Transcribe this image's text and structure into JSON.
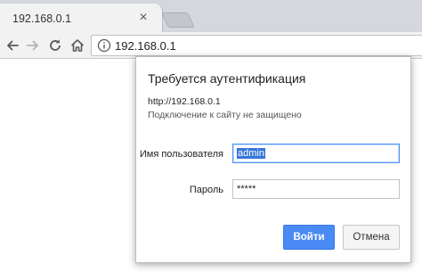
{
  "tab": {
    "title": "192.168.0.1",
    "close_glyph": "×"
  },
  "toolbar": {
    "back_icon": "back-arrow-icon",
    "forward_icon": "forward-arrow-icon",
    "reload_icon": "reload-icon",
    "home_icon": "home-icon",
    "url": "192.168.0.1"
  },
  "dialog": {
    "title": "Требуется аутентификация",
    "url": "http://192.168.0.1",
    "warning": "Подключение к сайту не защищено",
    "username_label": "Имя пользователя",
    "username_value": "admin",
    "password_label": "Пароль",
    "password_value": "*****",
    "login_button": "Войти",
    "cancel_button": "Отмена"
  },
  "colors": {
    "tabstrip": "#d4d7dc",
    "toolbar": "#f2f2f2",
    "accent": "#4a8af4",
    "selection": "#3875d7"
  }
}
